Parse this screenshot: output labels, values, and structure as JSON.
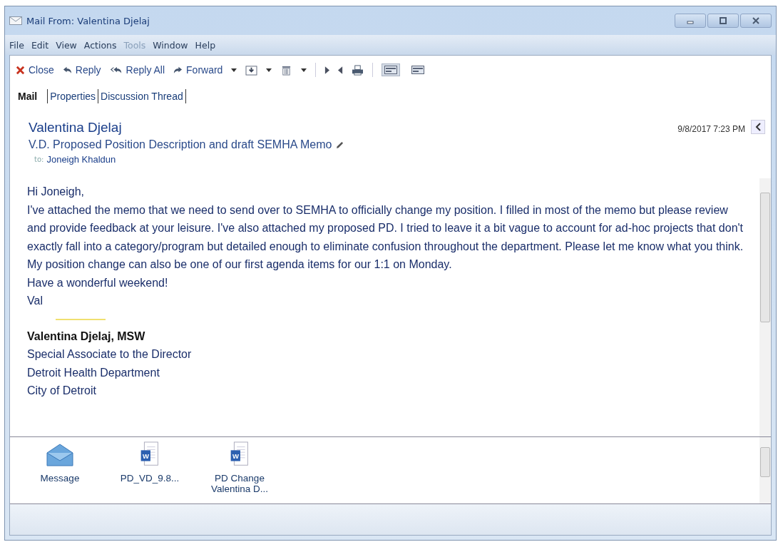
{
  "window": {
    "title": "Mail From: Valentina Djelaj"
  },
  "menu": [
    {
      "label": "File",
      "disabled": false
    },
    {
      "label": "Edit",
      "disabled": false
    },
    {
      "label": "View",
      "disabled": false
    },
    {
      "label": "Actions",
      "disabled": false
    },
    {
      "label": "Tools",
      "disabled": true
    },
    {
      "label": "Window",
      "disabled": false
    },
    {
      "label": "Help",
      "disabled": false
    }
  ],
  "toolbar": [
    {
      "kind": "close",
      "label": "Close"
    },
    {
      "kind": "reply",
      "label": "Reply"
    },
    {
      "kind": "reply_all",
      "label": "Reply All"
    },
    {
      "kind": "forward",
      "label": "Forward"
    },
    {
      "kind": "caret"
    },
    {
      "kind": "save"
    },
    {
      "kind": "caret"
    },
    {
      "kind": "delete"
    },
    {
      "kind": "caret"
    },
    {
      "kind": "separator"
    },
    {
      "kind": "next"
    },
    {
      "kind": "previous"
    },
    {
      "kind": "print"
    },
    {
      "kind": "separator"
    },
    {
      "kind": "view",
      "selected": true
    },
    {
      "kind": "view",
      "selected": false
    }
  ],
  "tabs": [
    {
      "label": "Mail",
      "selected": true
    },
    {
      "label": "Properties",
      "selected": false
    },
    {
      "label": "Discussion Thread",
      "selected": false
    }
  ],
  "header": {
    "from": "Valentina Djelaj",
    "subject": "V.D. Proposed Position Description and draft SEMHA Memo",
    "to_label": "to:",
    "to": "Joneigh Khaldun",
    "date": "9/8/2017 7:23 PM"
  },
  "body": [
    "Hi Joneigh,",
    "I've attached the memo that we need to send over to SEMHA to officially change my position. I filled in most of the memo but please review and provide feedback at your leisure. I've also attached my proposed PD. I tried to leave it a bit vague to account for ad-hoc projects that don't exactly fall into a category/program but detailed enough to eliminate confusion throughout the department. Please let me know what you think. My position change can also be one of our first agenda items for our 1:1 on Monday.",
    "Have a wonderful weekend!",
    "Val"
  ],
  "signature": {
    "name": "Valentina Djelaj, MSW",
    "lines": [
      "Special Associate to the Director",
      "Detroit Health Department",
      "City of Detroit"
    ]
  },
  "attachments": [
    {
      "kind": "message",
      "label": "Message"
    },
    {
      "kind": "word",
      "icon_letter": "W",
      "label": "PD_VD_9.8..."
    },
    {
      "kind": "word",
      "icon_letter": "W",
      "label": "PD Change Valentina D..."
    }
  ]
}
